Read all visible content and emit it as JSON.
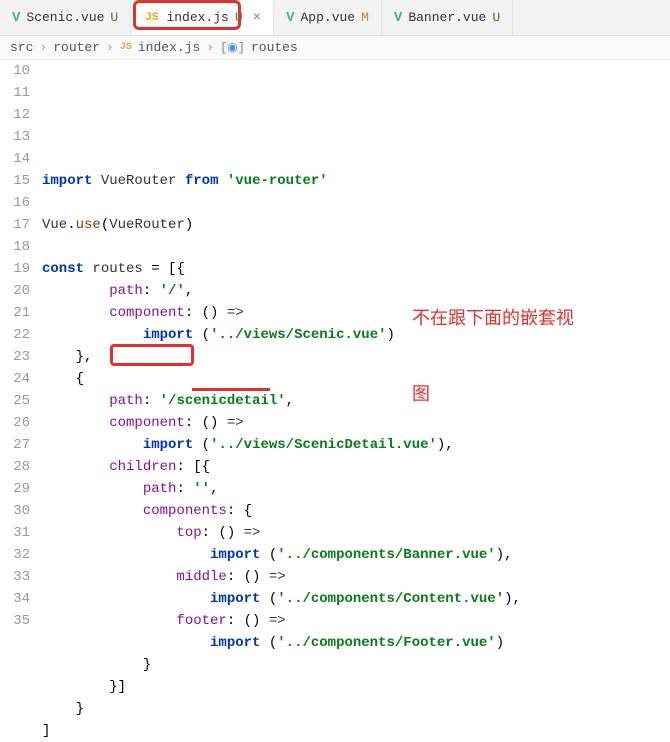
{
  "tabs": [
    {
      "icon": "vue",
      "label": "Scenic.vue",
      "status": "U",
      "statusClass": "status-u",
      "active": false
    },
    {
      "icon": "js",
      "label": "index.js",
      "status": "U",
      "statusClass": "status-u",
      "active": true,
      "closeable": true
    },
    {
      "icon": "vue",
      "label": "App.vue",
      "status": "M",
      "statusClass": "status-m",
      "active": false
    },
    {
      "icon": "vue",
      "label": "Banner.vue",
      "status": "U",
      "statusClass": "status-u",
      "active": false
    }
  ],
  "breadcrumb": {
    "p1": "src",
    "p2": "router",
    "p3": "index.js",
    "p4": "routes"
  },
  "annotation": {
    "line1": "不在跟下面的嵌套视",
    "line2": "图"
  },
  "code": {
    "lines": [
      {
        "n": "10",
        "html": "<span class='kw'>import</span> <span class='var'>VueRouter</span> <span class='kw'>from</span> <span class='str'>'vue-router'</span>"
      },
      {
        "n": "11",
        "html": ""
      },
      {
        "n": "12",
        "html": "<span class='var'>Vue</span>.<span class='fn'>use</span>(<span class='var'>VueRouter</span>)"
      },
      {
        "n": "13",
        "html": ""
      },
      {
        "n": "14",
        "html": "<span class='kw'>const</span> <span class='var'>routes</span> = [{"
      },
      {
        "n": "15",
        "html": "        <span class='prop'>path</span>: <span class='str'>'/'</span>,"
      },
      {
        "n": "16",
        "html": "        <span class='prop'>component</span>: () <span class='arrow'>=&gt;</span>"
      },
      {
        "n": "17",
        "html": "            <span class='kw'>import</span> (<span class='str'>'../views/Scenic.vue'</span>)"
      },
      {
        "n": "18",
        "html": "    },"
      },
      {
        "n": "19",
        "html": "    {"
      },
      {
        "n": "20",
        "html": "        <span class='prop'>path</span>: <span class='str'>'/scenicdetail'</span>,"
      },
      {
        "n": "21",
        "html": "        <span class='prop'>component</span>: () <span class='arrow'>=&gt;</span>"
      },
      {
        "n": "22",
        "html": "            <span class='kw'>import</span> (<span class='str'>'../views/ScenicDetail.vue'</span>),"
      },
      {
        "n": "23",
        "html": "        <span class='prop'>children</span>: [{"
      },
      {
        "n": "24",
        "html": "            <span class='prop'>path</span>: <span class='str'>''</span>,"
      },
      {
        "n": "25",
        "html": "            <span class='prop'>components</span>: {"
      },
      {
        "n": "26",
        "html": "                <span class='prop'>top</span>: () <span class='arrow'>=&gt;</span>"
      },
      {
        "n": "27",
        "html": "                    <span class='kw'>import</span> (<span class='str'>'../components/Banner.vue'</span>),"
      },
      {
        "n": "28",
        "html": "                <span class='prop'>middle</span>: () <span class='arrow'>=&gt;</span>"
      },
      {
        "n": "29",
        "html": "                    <span class='kw'>import</span> (<span class='str'>'../components/Content.vue'</span>),"
      },
      {
        "n": "30",
        "html": "                <span class='prop'>footer</span>: () <span class='arrow'>=&gt;</span>"
      },
      {
        "n": "31",
        "html": "                    <span class='kw'>import</span> (<span class='str'>'../components/Footer.vue'</span>)"
      },
      {
        "n": "32",
        "html": "            }"
      },
      {
        "n": "33",
        "html": "        }]"
      },
      {
        "n": "34",
        "html": "    }"
      },
      {
        "n": "35",
        "html": "]"
      }
    ]
  }
}
